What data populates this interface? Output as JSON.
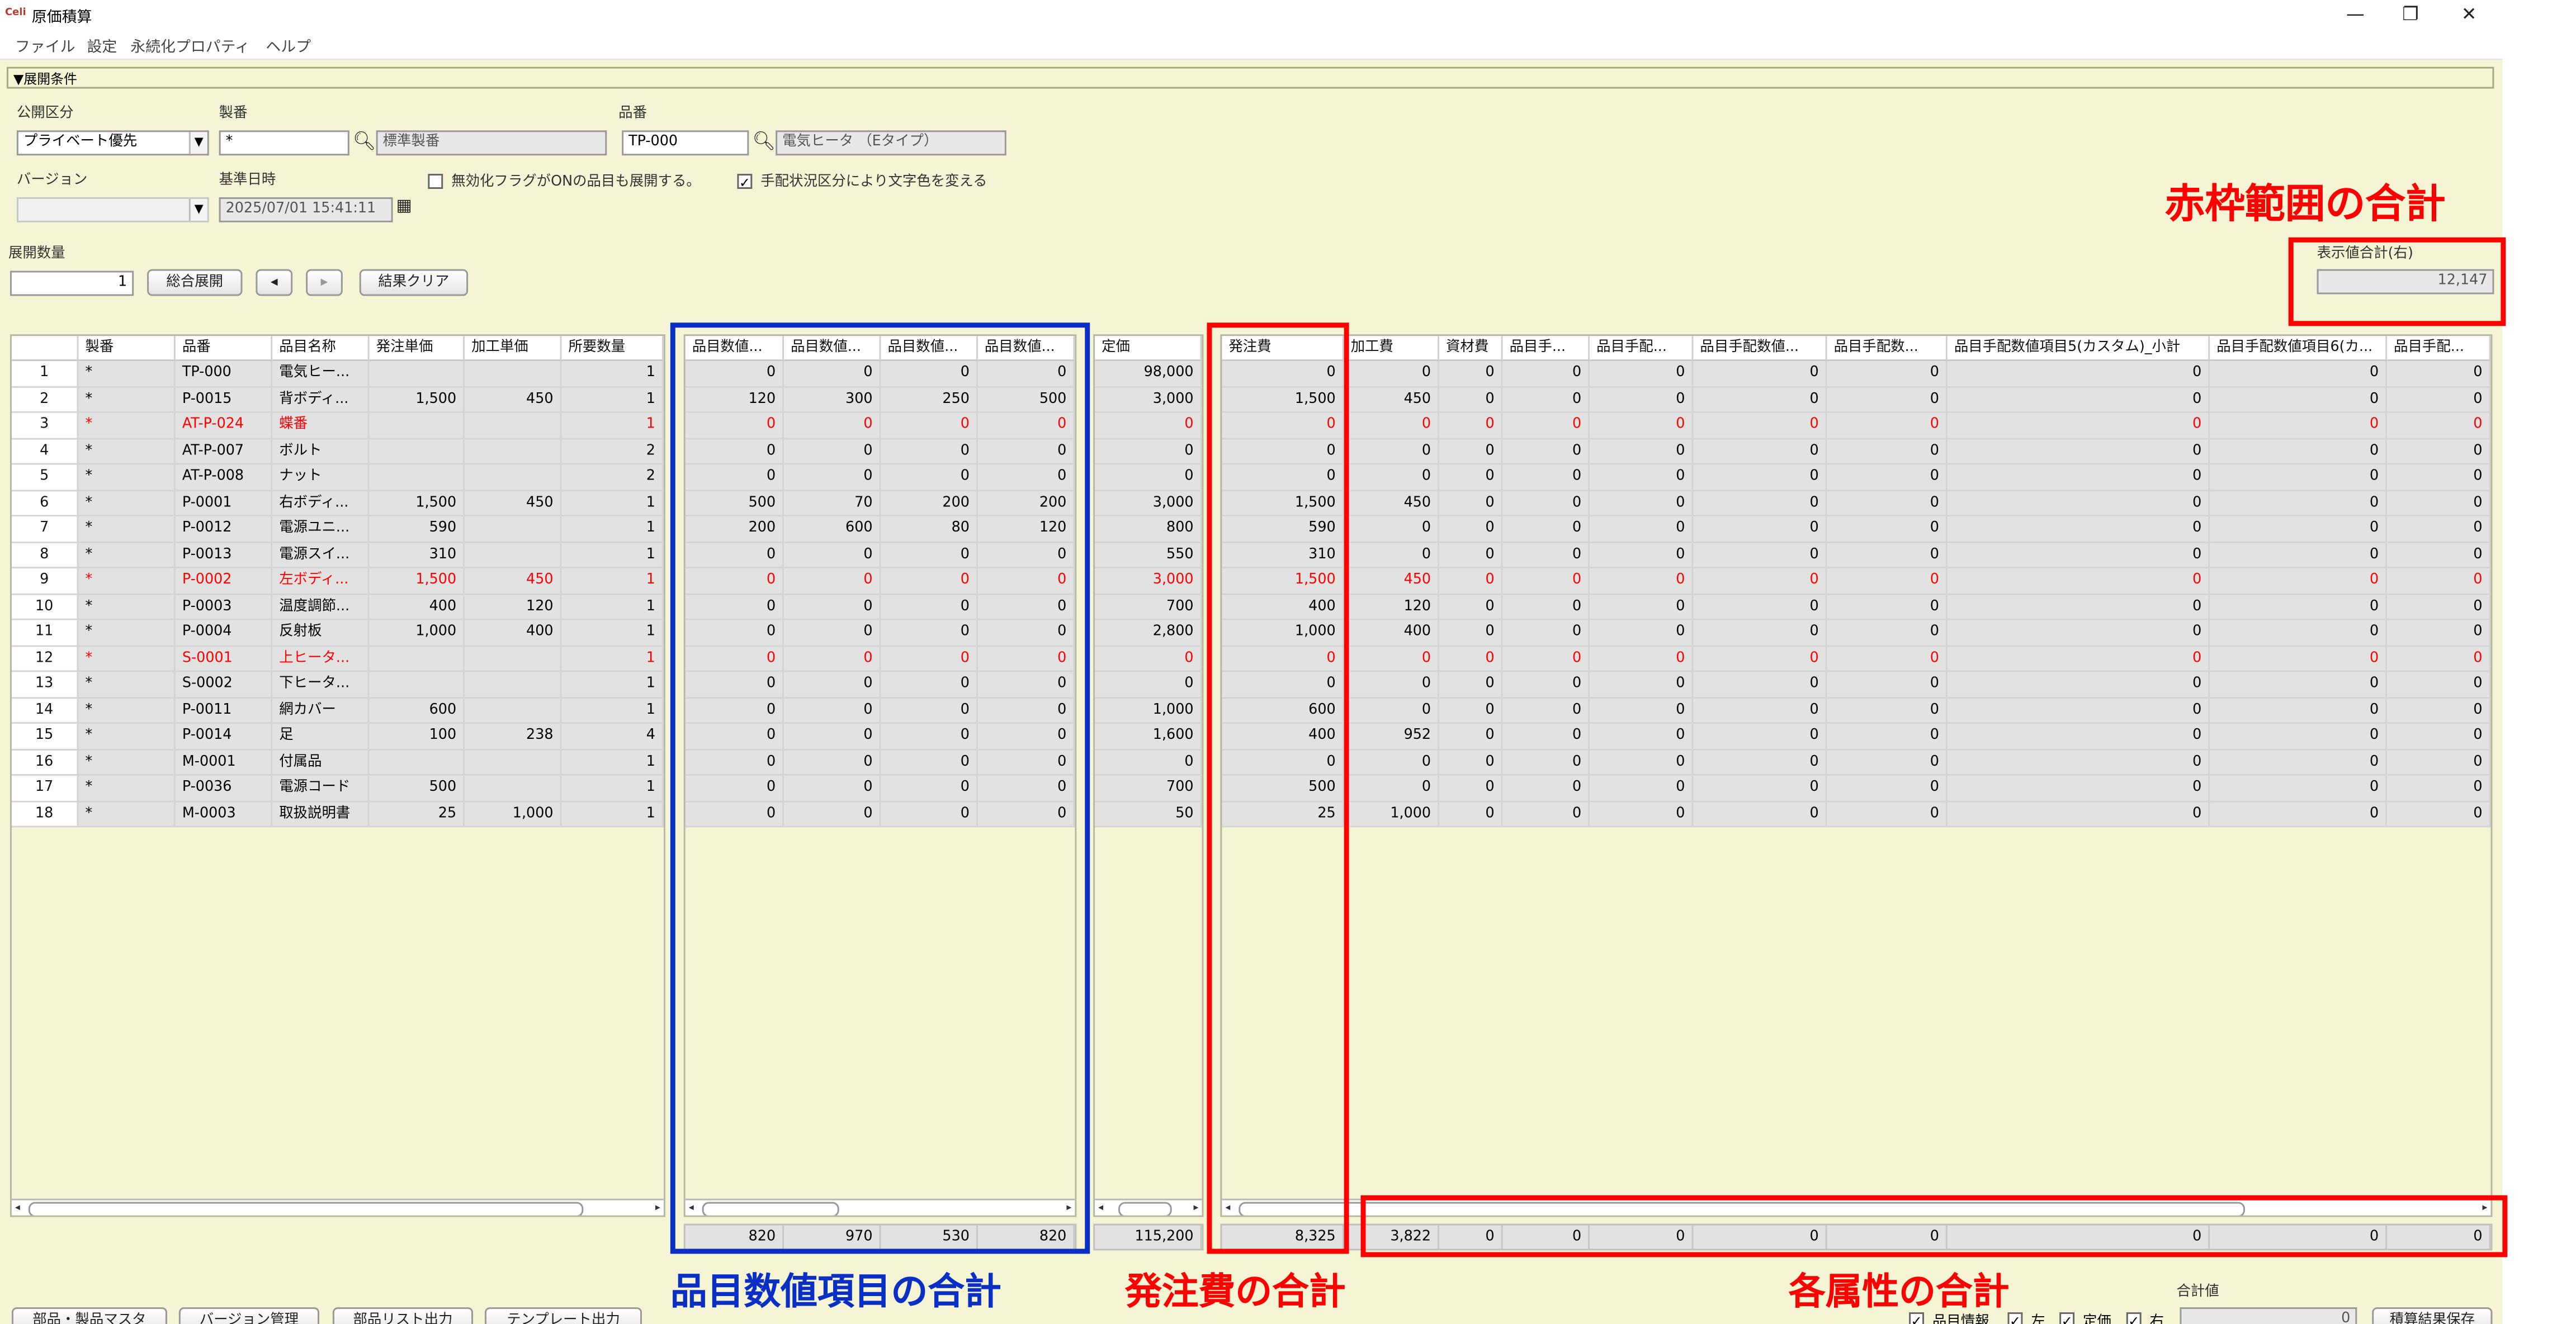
{
  "window": {
    "logo": "Celi",
    "title": "原価積算",
    "minimize": "—",
    "maximize": "❐",
    "close": "✕"
  },
  "menu": [
    "ファイル",
    "設定",
    "永続化プロパティ",
    "ヘルプ"
  ],
  "conditions": {
    "header": "▼展開条件",
    "publish_label": "公開区分",
    "publish_value": "プライベート優先",
    "seiban_label": "製番",
    "seiban_value": "*",
    "seiban_name": "標準製番",
    "hinban_label": "品番",
    "hinban_value": "TP-000",
    "hinban_name": "電気ヒータ （Eタイプ）",
    "version_label": "バージョン",
    "version_value": "",
    "date_label": "基準日時",
    "date_value": "2025/07/01 15:41:11",
    "cb1_label": "無効化フラグがONの品目も展開する。",
    "cb1_checked": false,
    "cb2_label": "手配状況区分により文字色を変える",
    "cb2_checked": true
  },
  "expand": {
    "qty_label": "展開数量",
    "qty_value": "1",
    "expand_btn": "総合展開",
    "prev_btn": "◂",
    "next_btn": "▸",
    "clear_btn": "結果クリア"
  },
  "display_total": {
    "label": "表示値合計(右)",
    "value": "12,147"
  },
  "grid": {
    "headers": {
      "left": [
        "",
        "製番",
        "品番",
        "品目名称",
        "発注単価",
        "加工単価",
        "所要数量"
      ],
      "num": [
        "品目数値...",
        "品目数値...",
        "品目数値...",
        "品目数値..."
      ],
      "price": [
        "定価"
      ],
      "right": [
        "発注費",
        "加工費",
        "資材費",
        "品目手...",
        "品目手配...",
        "品目手配数値...",
        "品目手配数...",
        "品目手配数値項目5(カスタム)_小計",
        "品目手配数値項目6(カ...",
        "品目手配..."
      ]
    },
    "rows": [
      {
        "no": "1",
        "seiban": "*",
        "hinban": "TP-000",
        "name": "電気ヒー...",
        "order_price": "",
        "proc_price": "",
        "qty": "1",
        "n": [
          "0",
          "0",
          "0",
          "0"
        ],
        "list_price": "98,000",
        "r": [
          "0",
          "0",
          "0",
          "0",
          "0",
          "0",
          "0",
          "0",
          "0",
          "0"
        ],
        "red": false
      },
      {
        "no": "2",
        "seiban": "*",
        "hinban": "P-0015",
        "name": "背ボディ...",
        "order_price": "1,500",
        "proc_price": "450",
        "qty": "1",
        "n": [
          "120",
          "300",
          "250",
          "500"
        ],
        "list_price": "3,000",
        "r": [
          "1,500",
          "450",
          "0",
          "0",
          "0",
          "0",
          "0",
          "0",
          "0",
          "0"
        ],
        "red": false
      },
      {
        "no": "3",
        "seiban": "*",
        "hinban": "AT-P-024",
        "name": "蝶番",
        "order_price": "",
        "proc_price": "",
        "qty": "1",
        "n": [
          "0",
          "0",
          "0",
          "0"
        ],
        "list_price": "0",
        "r": [
          "0",
          "0",
          "0",
          "0",
          "0",
          "0",
          "0",
          "0",
          "0",
          "0"
        ],
        "red": true
      },
      {
        "no": "4",
        "seiban": "*",
        "hinban": "AT-P-007",
        "name": "ボルト",
        "order_price": "",
        "proc_price": "",
        "qty": "2",
        "n": [
          "0",
          "0",
          "0",
          "0"
        ],
        "list_price": "0",
        "r": [
          "0",
          "0",
          "0",
          "0",
          "0",
          "0",
          "0",
          "0",
          "0",
          "0"
        ],
        "red": false
      },
      {
        "no": "5",
        "seiban": "*",
        "hinban": "AT-P-008",
        "name": "ナット",
        "order_price": "",
        "proc_price": "",
        "qty": "2",
        "n": [
          "0",
          "0",
          "0",
          "0"
        ],
        "list_price": "0",
        "r": [
          "0",
          "0",
          "0",
          "0",
          "0",
          "0",
          "0",
          "0",
          "0",
          "0"
        ],
        "red": false
      },
      {
        "no": "6",
        "seiban": "*",
        "hinban": "P-0001",
        "name": "右ボディ...",
        "order_price": "1,500",
        "proc_price": "450",
        "qty": "1",
        "n": [
          "500",
          "70",
          "200",
          "200"
        ],
        "list_price": "3,000",
        "r": [
          "1,500",
          "450",
          "0",
          "0",
          "0",
          "0",
          "0",
          "0",
          "0",
          "0"
        ],
        "red": false
      },
      {
        "no": "7",
        "seiban": "*",
        "hinban": "P-0012",
        "name": "電源ユニ...",
        "order_price": "590",
        "proc_price": "",
        "qty": "1",
        "n": [
          "200",
          "600",
          "80",
          "120"
        ],
        "list_price": "800",
        "r": [
          "590",
          "0",
          "0",
          "0",
          "0",
          "0",
          "0",
          "0",
          "0",
          "0"
        ],
        "red": false
      },
      {
        "no": "8",
        "seiban": "*",
        "hinban": "P-0013",
        "name": "電源スイ...",
        "order_price": "310",
        "proc_price": "",
        "qty": "1",
        "n": [
          "0",
          "0",
          "0",
          "0"
        ],
        "list_price": "550",
        "r": [
          "310",
          "0",
          "0",
          "0",
          "0",
          "0",
          "0",
          "0",
          "0",
          "0"
        ],
        "red": false
      },
      {
        "no": "9",
        "seiban": "*",
        "hinban": "P-0002",
        "name": "左ボディ...",
        "order_price": "1,500",
        "proc_price": "450",
        "qty": "1",
        "n": [
          "0",
          "0",
          "0",
          "0"
        ],
        "list_price": "3,000",
        "r": [
          "1,500",
          "450",
          "0",
          "0",
          "0",
          "0",
          "0",
          "0",
          "0",
          "0"
        ],
        "red": true
      },
      {
        "no": "10",
        "seiban": "*",
        "hinban": "P-0003",
        "name": "温度調節...",
        "order_price": "400",
        "proc_price": "120",
        "qty": "1",
        "n": [
          "0",
          "0",
          "0",
          "0"
        ],
        "list_price": "700",
        "r": [
          "400",
          "120",
          "0",
          "0",
          "0",
          "0",
          "0",
          "0",
          "0",
          "0"
        ],
        "red": false
      },
      {
        "no": "11",
        "seiban": "*",
        "hinban": "P-0004",
        "name": "反射板",
        "order_price": "1,000",
        "proc_price": "400",
        "qty": "1",
        "n": [
          "0",
          "0",
          "0",
          "0"
        ],
        "list_price": "2,800",
        "r": [
          "1,000",
          "400",
          "0",
          "0",
          "0",
          "0",
          "0",
          "0",
          "0",
          "0"
        ],
        "red": false
      },
      {
        "no": "12",
        "seiban": "*",
        "hinban": "S-0001",
        "name": "上ヒータ...",
        "order_price": "",
        "proc_price": "",
        "qty": "1",
        "n": [
          "0",
          "0",
          "0",
          "0"
        ],
        "list_price": "0",
        "r": [
          "0",
          "0",
          "0",
          "0",
          "0",
          "0",
          "0",
          "0",
          "0",
          "0"
        ],
        "red": true
      },
      {
        "no": "13",
        "seiban": "*",
        "hinban": "S-0002",
        "name": "下ヒータ...",
        "order_price": "",
        "proc_price": "",
        "qty": "1",
        "n": [
          "0",
          "0",
          "0",
          "0"
        ],
        "list_price": "0",
        "r": [
          "0",
          "0",
          "0",
          "0",
          "0",
          "0",
          "0",
          "0",
          "0",
          "0"
        ],
        "red": false
      },
      {
        "no": "14",
        "seiban": "*",
        "hinban": "P-0011",
        "name": "網カバー",
        "order_price": "600",
        "proc_price": "",
        "qty": "1",
        "n": [
          "0",
          "0",
          "0",
          "0"
        ],
        "list_price": "1,000",
        "r": [
          "600",
          "0",
          "0",
          "0",
          "0",
          "0",
          "0",
          "0",
          "0",
          "0"
        ],
        "red": false
      },
      {
        "no": "15",
        "seiban": "*",
        "hinban": "P-0014",
        "name": "足",
        "order_price": "100",
        "proc_price": "238",
        "qty": "4",
        "n": [
          "0",
          "0",
          "0",
          "0"
        ],
        "list_price": "1,600",
        "r": [
          "400",
          "952",
          "0",
          "0",
          "0",
          "0",
          "0",
          "0",
          "0",
          "0"
        ],
        "red": false
      },
      {
        "no": "16",
        "seiban": "*",
        "hinban": "M-0001",
        "name": "付属品",
        "order_price": "",
        "proc_price": "",
        "qty": "1",
        "n": [
          "0",
          "0",
          "0",
          "0"
        ],
        "list_price": "0",
        "r": [
          "0",
          "0",
          "0",
          "0",
          "0",
          "0",
          "0",
          "0",
          "0",
          "0"
        ],
        "red": false
      },
      {
        "no": "17",
        "seiban": "*",
        "hinban": "P-0036",
        "name": "電源コード",
        "order_price": "500",
        "proc_price": "",
        "qty": "1",
        "n": [
          "0",
          "0",
          "0",
          "0"
        ],
        "list_price": "700",
        "r": [
          "500",
          "0",
          "0",
          "0",
          "0",
          "0",
          "0",
          "0",
          "0",
          "0"
        ],
        "red": false
      },
      {
        "no": "18",
        "seiban": "*",
        "hinban": "M-0003",
        "name": "取扱説明書",
        "order_price": "25",
        "proc_price": "1,000",
        "qty": "1",
        "n": [
          "0",
          "0",
          "0",
          "0"
        ],
        "list_price": "50",
        "r": [
          "25",
          "1,000",
          "0",
          "0",
          "0",
          "0",
          "0",
          "0",
          "0",
          "0"
        ],
        "red": false
      }
    ],
    "totals": {
      "n": [
        "820",
        "970",
        "530",
        "820"
      ],
      "list_price": "115,200",
      "r": [
        "8,325",
        "3,822",
        "0",
        "0",
        "0",
        "0",
        "0",
        "0",
        "0",
        "0"
      ]
    }
  },
  "footer": {
    "buttons": [
      "部品・製品マスタ",
      "バージョン管理",
      "部品リスト出力",
      "テンプレート出力"
    ],
    "total_label": "合計値",
    "total_value": "0",
    "checks": [
      {
        "label": "品目情報",
        "checked": true
      },
      {
        "label": "左",
        "checked": true
      },
      {
        "label": "定価",
        "checked": true
      },
      {
        "label": "右",
        "checked": true
      }
    ],
    "save_btn": "積算結果保存"
  },
  "annotations": {
    "red_total": "赤枠範囲の合計",
    "num_total": "品目数値項目の合計",
    "order_total": "発注費の合計",
    "attr_total": "各属性の合計"
  },
  "colors": {
    "annotation_red": "#ff0000",
    "annotation_blue": "#0a2fc4",
    "row_red": "#ff0000",
    "background": "#f5f5d5"
  }
}
